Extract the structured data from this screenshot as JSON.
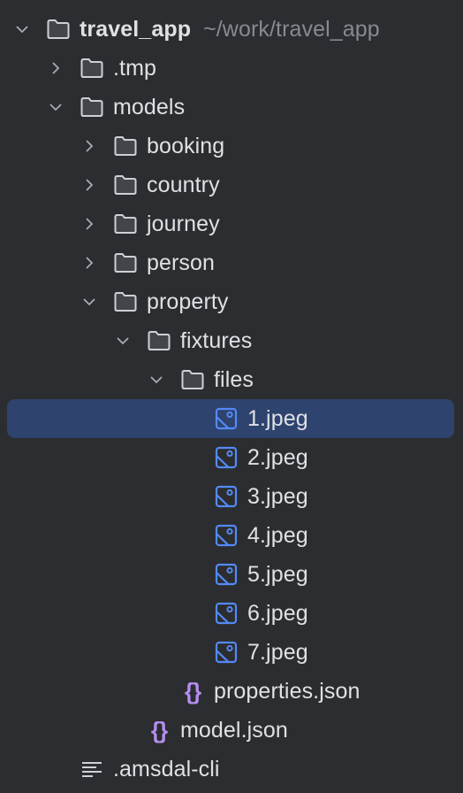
{
  "project_tree": {
    "root": {
      "name": "travel_app",
      "path": "~/work/travel_app",
      "expanded": true
    },
    "items": [
      {
        "name": ".tmp",
        "type": "folder",
        "expanded": false,
        "depth": 1
      },
      {
        "name": "models",
        "type": "folder",
        "expanded": true,
        "depth": 1
      },
      {
        "name": "booking",
        "type": "folder",
        "expanded": false,
        "depth": 2
      },
      {
        "name": "country",
        "type": "folder",
        "expanded": false,
        "depth": 2
      },
      {
        "name": "journey",
        "type": "folder",
        "expanded": false,
        "depth": 2
      },
      {
        "name": "person",
        "type": "folder",
        "expanded": false,
        "depth": 2
      },
      {
        "name": "property",
        "type": "folder",
        "expanded": true,
        "depth": 2
      },
      {
        "name": "fixtures",
        "type": "folder",
        "expanded": true,
        "depth": 3
      },
      {
        "name": "files",
        "type": "folder",
        "expanded": true,
        "depth": 4
      },
      {
        "name": "1.jpeg",
        "type": "image",
        "selected": true,
        "depth": 5
      },
      {
        "name": "2.jpeg",
        "type": "image",
        "depth": 5
      },
      {
        "name": "3.jpeg",
        "type": "image",
        "depth": 5
      },
      {
        "name": "4.jpeg",
        "type": "image",
        "depth": 5
      },
      {
        "name": "5.jpeg",
        "type": "image",
        "depth": 5
      },
      {
        "name": "6.jpeg",
        "type": "image",
        "depth": 5
      },
      {
        "name": "7.jpeg",
        "type": "image",
        "depth": 5
      },
      {
        "name": "properties.json",
        "type": "json",
        "depth": 4
      },
      {
        "name": "model.json",
        "type": "json",
        "depth": 3
      },
      {
        "name": ".amsdal-cli",
        "type": "text",
        "depth": 1
      }
    ]
  },
  "colors": {
    "background": "#2b2d30",
    "selection": "#2e436e",
    "text": "#dfe1e5",
    "path_text": "#868a91",
    "image_icon": "#548af7",
    "json_icon": "#b48ef0"
  }
}
